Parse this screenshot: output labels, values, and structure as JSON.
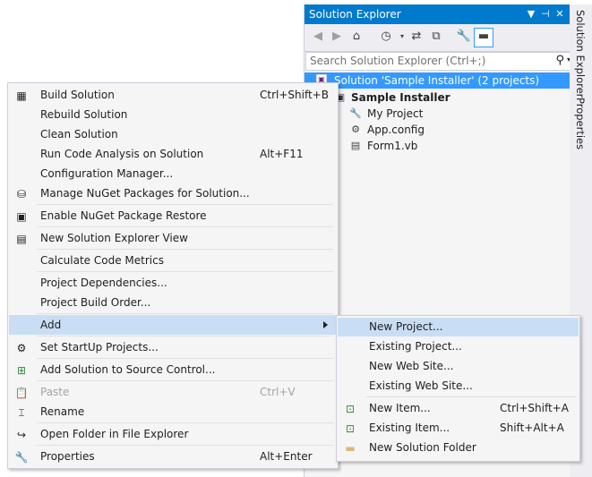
{
  "solution_explorer": {
    "title": "Solution Explorer",
    "search_placeholder": "Search Solution Explorer (Ctrl+;)",
    "tree": {
      "solution_label": "Solution 'Sample Installer' (2 projects)",
      "project_label": "Sample Installer",
      "items": [
        "My Project",
        "App.config",
        "Form1.vb"
      ]
    }
  },
  "side_tabs": {
    "solution_explorer": "Solution Explorer",
    "properties": "Properties"
  },
  "context_menu": {
    "items": [
      {
        "label": "Build Solution",
        "shortcut": "Ctrl+Shift+B"
      },
      {
        "label": "Rebuild Solution",
        "shortcut": ""
      },
      {
        "label": "Clean Solution",
        "shortcut": ""
      },
      {
        "label": "Run Code Analysis on Solution",
        "shortcut": "Alt+F11"
      },
      {
        "label": "Configuration Manager...",
        "shortcut": ""
      },
      {
        "label": "Manage NuGet Packages for Solution...",
        "shortcut": ""
      },
      {
        "label": "Enable NuGet Package Restore",
        "shortcut": ""
      },
      {
        "label": "New Solution Explorer View",
        "shortcut": ""
      },
      {
        "label": "Calculate Code Metrics",
        "shortcut": ""
      },
      {
        "label": "Project Dependencies...",
        "shortcut": ""
      },
      {
        "label": "Project Build Order...",
        "shortcut": ""
      },
      {
        "label": "Add",
        "shortcut": ""
      },
      {
        "label": "Set StartUp Projects...",
        "shortcut": ""
      },
      {
        "label": "Add Solution to Source Control...",
        "shortcut": ""
      },
      {
        "label": "Paste",
        "shortcut": "Ctrl+V"
      },
      {
        "label": "Rename",
        "shortcut": ""
      },
      {
        "label": "Open Folder in File Explorer",
        "shortcut": ""
      },
      {
        "label": "Properties",
        "shortcut": "Alt+Enter"
      }
    ]
  },
  "add_submenu": {
    "items": [
      {
        "label": "New Project...",
        "shortcut": ""
      },
      {
        "label": "Existing Project...",
        "shortcut": ""
      },
      {
        "label": "New Web Site...",
        "shortcut": ""
      },
      {
        "label": "Existing Web Site...",
        "shortcut": ""
      },
      {
        "label": "New Item...",
        "shortcut": "Ctrl+Shift+A"
      },
      {
        "label": "Existing Item...",
        "shortcut": "Shift+Alt+A"
      },
      {
        "label": "New Solution Folder",
        "shortcut": ""
      }
    ]
  },
  "colors": {
    "accent": "#007acc",
    "selection": "#3399ff",
    "menu_highlight": "#c9def5"
  }
}
